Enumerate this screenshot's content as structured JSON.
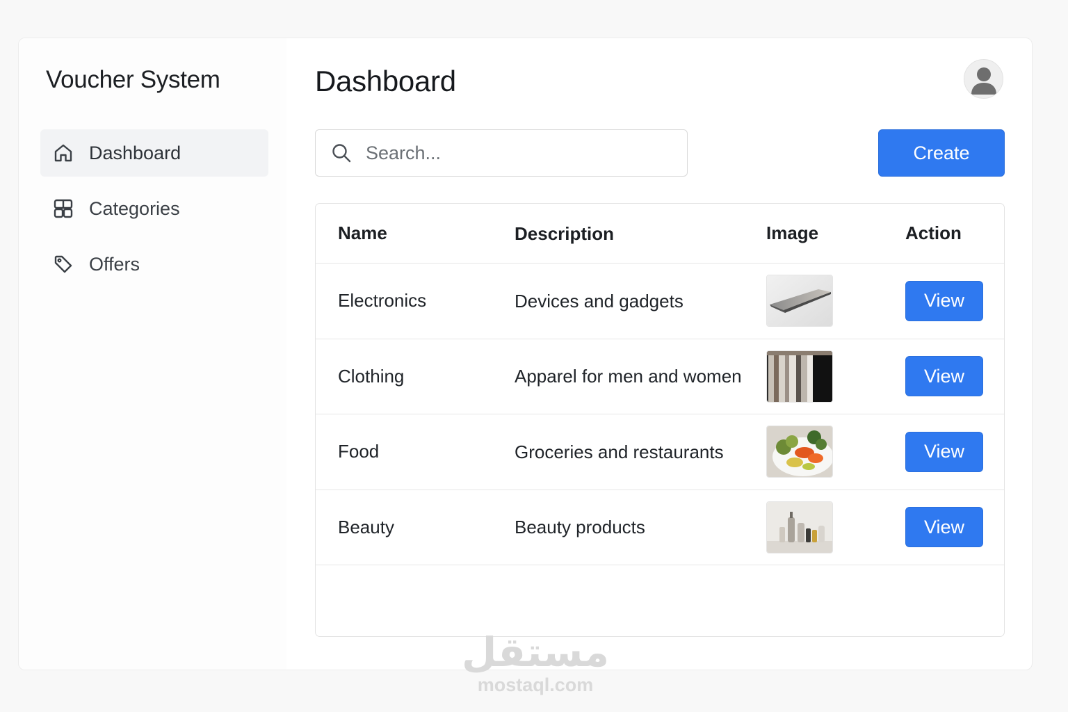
{
  "sidebar": {
    "app_title": "Voucher System",
    "items": [
      {
        "label": "Dashboard",
        "icon": "home-icon",
        "active": true
      },
      {
        "label": "Categories",
        "icon": "grid-icon",
        "active": false
      },
      {
        "label": "Offers",
        "icon": "tag-icon",
        "active": false
      }
    ]
  },
  "header": {
    "page_title": "Dashboard",
    "avatar_icon": "user-avatar-icon"
  },
  "toolbar": {
    "search_placeholder": "Search...",
    "create_label": "Create"
  },
  "table": {
    "columns": [
      "Name",
      "Description",
      "Image",
      "Action"
    ],
    "rows": [
      {
        "name": "Electronics",
        "description": "Devices and gadgets",
        "image": "laptop-thumbnail",
        "action": "View"
      },
      {
        "name": "Clothing",
        "description": "Apparel for men and women",
        "image": "clothing-rack-thumbnail",
        "action": "View"
      },
      {
        "name": "Food",
        "description": "Groceries and restaurants",
        "image": "food-plate-thumbnail",
        "action": "View"
      },
      {
        "name": "Beauty",
        "description": "Beauty products",
        "image": "beauty-bottles-thumbnail",
        "action": "View"
      }
    ]
  },
  "watermark": {
    "arabic": "مستقل",
    "latin": "mostaql.com"
  },
  "colors": {
    "accent": "#2f79f0",
    "active_nav_bg": "#f2f3f5",
    "border": "#e3e3e3"
  }
}
